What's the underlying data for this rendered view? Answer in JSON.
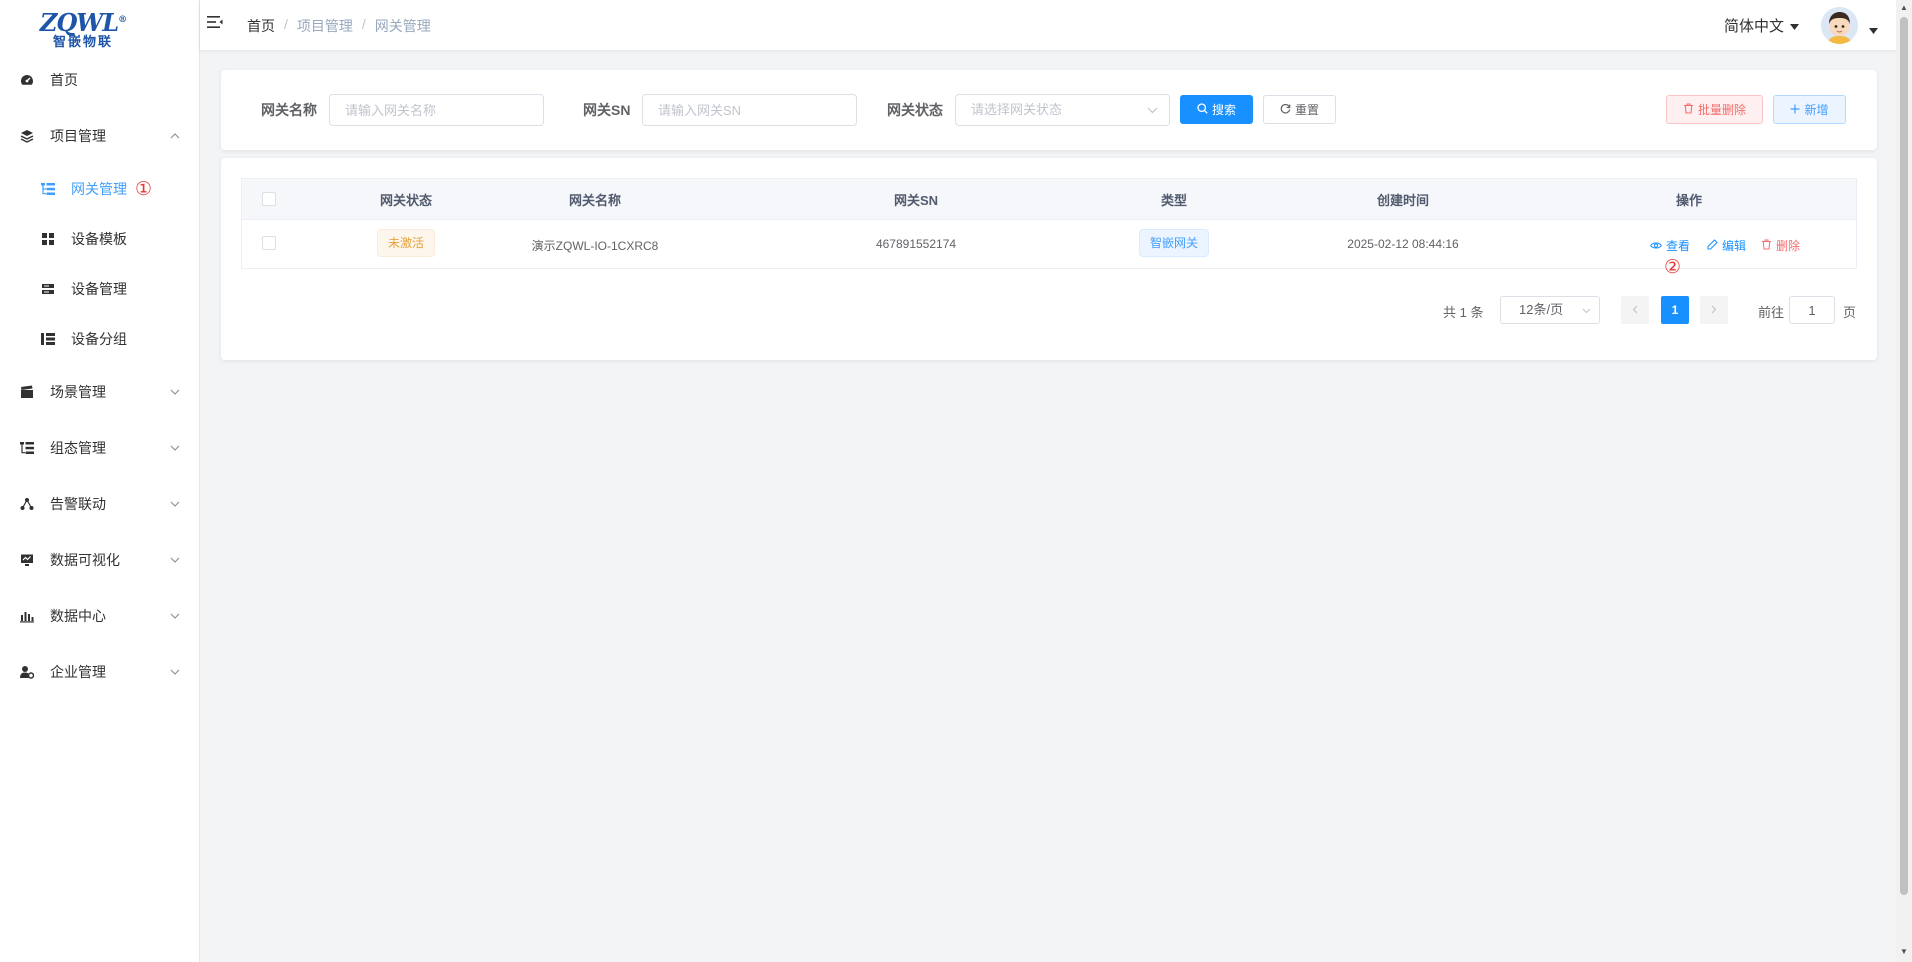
{
  "logo": {
    "top": "ZQWL",
    "registered": "®",
    "bottom": "智嵌物联"
  },
  "sidebar": {
    "items": [
      {
        "label": "首页",
        "icon": "dashboard-icon"
      },
      {
        "label": "项目管理",
        "icon": "layers-icon",
        "expanded": true
      },
      {
        "label": "网关管理",
        "icon": "tree-list-icon",
        "active": true,
        "marker": "①"
      },
      {
        "label": "设备模板",
        "icon": "grid-icon"
      },
      {
        "label": "设备管理",
        "icon": "server-icon"
      },
      {
        "label": "设备分组",
        "icon": "group-icon"
      },
      {
        "label": "场景管理",
        "icon": "clapperboard-icon"
      },
      {
        "label": "组态管理",
        "icon": "tree-table-icon"
      },
      {
        "label": "告警联动",
        "icon": "network-icon"
      },
      {
        "label": "数据可视化",
        "icon": "monitor-icon"
      },
      {
        "label": "数据中心",
        "icon": "bar-chart-icon"
      },
      {
        "label": "企业管理",
        "icon": "user-gear-icon"
      }
    ]
  },
  "header": {
    "breadcrumb": [
      "首页",
      "项目管理",
      "网关管理"
    ],
    "separator": "/",
    "language": "简体中文"
  },
  "search": {
    "name_label": "网关名称",
    "name_placeholder": "请输入网关名称",
    "sn_label": "网关SN",
    "sn_placeholder": "请输入网关SN",
    "status_label": "网关状态",
    "status_placeholder": "请选择网关状态",
    "search_button": "搜索",
    "reset_button": "重置",
    "batch_delete_button": "批量删除",
    "add_button": "新增"
  },
  "table": {
    "columns": [
      "网关状态",
      "网关名称",
      "网关SN",
      "类型",
      "创建时间",
      "操作"
    ],
    "rows": [
      {
        "status": "未激活",
        "name": "演示ZQWL-IO-1CXRC8",
        "sn": "467891552174",
        "type": "智嵌网关",
        "created": "2025-02-12 08:44:16",
        "actions": {
          "view": "查看",
          "edit": "编辑",
          "delete": "删除"
        },
        "marker": "②"
      }
    ]
  },
  "pagination": {
    "total_text": "共 1 条",
    "page_size": "12条/页",
    "current_page": "1",
    "goto_prefix": "前往",
    "goto_value": "1",
    "goto_suffix": "页"
  },
  "colors": {
    "primary": "#1890ff",
    "active_menu": "#409eff",
    "danger": "#f56c6c",
    "warning": "#e6a23c",
    "marker": "#e53935"
  }
}
